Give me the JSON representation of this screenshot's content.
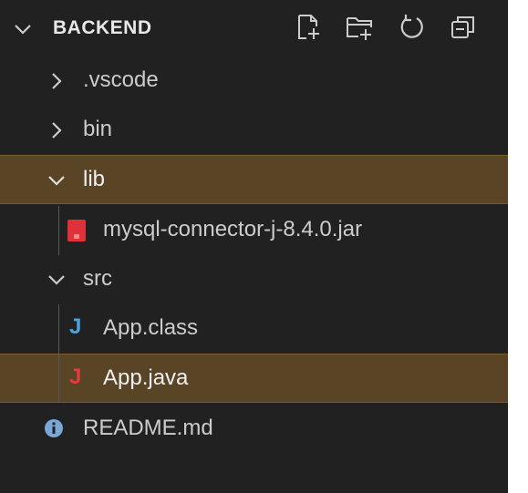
{
  "explorer": {
    "title": "BACKEND",
    "actions": [
      {
        "name": "new-file-icon"
      },
      {
        "name": "new-folder-icon"
      },
      {
        "name": "refresh-icon"
      },
      {
        "name": "collapse-all-icon"
      }
    ],
    "items": [
      {
        "label": ".vscode",
        "type": "folder",
        "expanded": false
      },
      {
        "label": "bin",
        "type": "folder",
        "expanded": false
      },
      {
        "label": "lib",
        "type": "folder",
        "expanded": true,
        "selected": true
      },
      {
        "label": "mysql-connector-j-8.4.0.jar",
        "type": "jar"
      },
      {
        "label": "src",
        "type": "folder",
        "expanded": true
      },
      {
        "label": "App.class",
        "type": "java-class",
        "icon_glyph": "J"
      },
      {
        "label": "App.java",
        "type": "java-source",
        "icon_glyph": "J",
        "selected": true
      },
      {
        "label": "README.md",
        "type": "markdown"
      }
    ]
  },
  "colors": {
    "background": "#212121",
    "selection": "#5a4426",
    "text": "#cccccc",
    "jar_icon": "#e0303a",
    "java_class_icon": "#4aa3df",
    "java_source_icon": "#e03c3c",
    "info_icon": "#7aa7d6"
  }
}
